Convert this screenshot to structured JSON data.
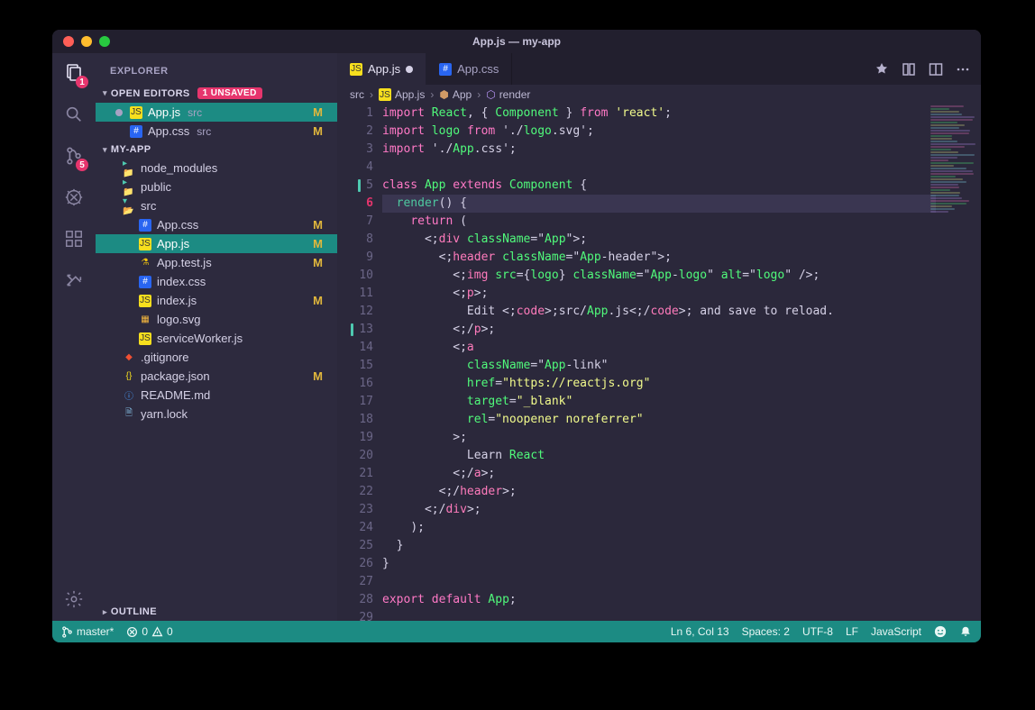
{
  "window": {
    "title": "App.js — my-app"
  },
  "activitybar": {
    "items": [
      {
        "name": "explorer",
        "badge": "1"
      },
      {
        "name": "search",
        "badge": null
      },
      {
        "name": "source-control",
        "badge": "5"
      },
      {
        "name": "debug",
        "badge": null
      },
      {
        "name": "extensions",
        "badge": null
      },
      {
        "name": "git-graph",
        "badge": null
      }
    ]
  },
  "sidebar": {
    "header": "EXPLORER",
    "openEditors": {
      "title": "OPEN EDITORS",
      "unsavedBadge": "1 UNSAVED",
      "items": [
        {
          "name": "App.js",
          "path": "src",
          "modified": true,
          "status": "M",
          "active": true
        },
        {
          "name": "App.css",
          "path": "src",
          "modified": false,
          "status": "M",
          "active": false
        }
      ]
    },
    "project": {
      "title": "MY-APP",
      "tree": [
        {
          "name": "node_modules",
          "type": "folder",
          "depth": 1
        },
        {
          "name": "public",
          "type": "folder",
          "depth": 1
        },
        {
          "name": "src",
          "type": "folder-open",
          "depth": 1
        },
        {
          "name": "App.css",
          "type": "css",
          "depth": 2,
          "status": "M"
        },
        {
          "name": "App.js",
          "type": "js",
          "depth": 2,
          "status": "M",
          "selected": true
        },
        {
          "name": "App.test.js",
          "type": "test",
          "depth": 2,
          "status": "M"
        },
        {
          "name": "index.css",
          "type": "css",
          "depth": 2
        },
        {
          "name": "index.js",
          "type": "js",
          "depth": 2,
          "status": "M"
        },
        {
          "name": "logo.svg",
          "type": "svg",
          "depth": 2
        },
        {
          "name": "serviceWorker.js",
          "type": "js",
          "depth": 2
        },
        {
          "name": ".gitignore",
          "type": "git",
          "depth": 1
        },
        {
          "name": "package.json",
          "type": "json",
          "depth": 1,
          "status": "M"
        },
        {
          "name": "README.md",
          "type": "md",
          "depth": 1
        },
        {
          "name": "yarn.lock",
          "type": "lock",
          "depth": 1
        }
      ]
    },
    "outline": {
      "title": "OUTLINE"
    }
  },
  "tabs": {
    "items": [
      {
        "name": "App.js",
        "type": "js",
        "modified": true,
        "active": true
      },
      {
        "name": "App.css",
        "type": "css",
        "modified": false,
        "active": false
      }
    ]
  },
  "breadcrumbs": {
    "parts": [
      {
        "label": "src",
        "icon": null
      },
      {
        "label": "App.js",
        "icon": "js"
      },
      {
        "label": "App",
        "icon": "class"
      },
      {
        "label": "render",
        "icon": "method"
      }
    ]
  },
  "editor": {
    "lines": [
      "import React, { Component } from 'react';",
      "import logo from './logo.svg';",
      "import './App.css';",
      "",
      "class App extends Component {",
      "  render() {",
      "    return (",
      "      <div className=\"App\">",
      "        <header className=\"App-header\">",
      "          <img src={logo} className=\"App-logo\" alt=\"logo\" />",
      "          <p>",
      "            Edit <code>src/App.js</code> and save to reload.",
      "          </p>",
      "          <a",
      "            className=\"App-link\"",
      "            href=\"https://reactjs.org\"",
      "            target=\"_blank\"",
      "            rel=\"noopener noreferrer\"",
      "          >",
      "            Learn React",
      "          </a>",
      "        </header>",
      "      </div>",
      "    );",
      "  }",
      "}",
      "",
      "export default App;",
      ""
    ],
    "currentLine": 6,
    "errorLine": 6,
    "markedLines": [
      5,
      13
    ]
  },
  "status": {
    "branch": "master*",
    "errors": "0",
    "warnings": "0",
    "cursor": "Ln 6, Col 13",
    "spaces": "Spaces: 2",
    "encoding": "UTF-8",
    "eol": "LF",
    "language": "JavaScript"
  }
}
